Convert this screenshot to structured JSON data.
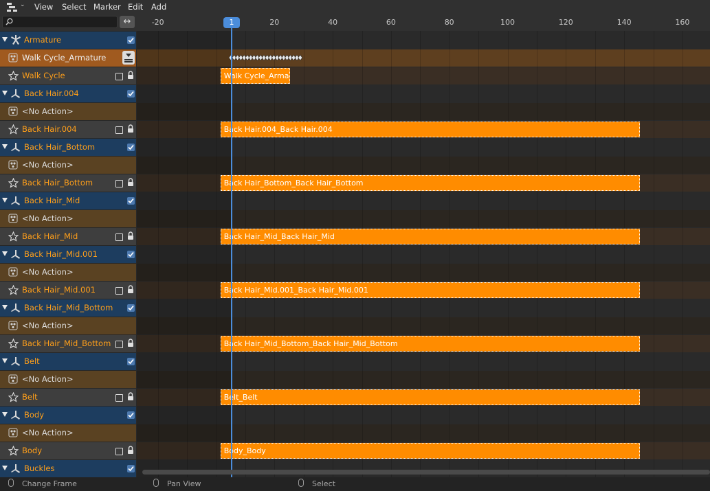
{
  "header": {
    "editor_type_icon": "nla-editor-icon",
    "menus": [
      "View",
      "Select",
      "Marker",
      "Edit",
      "Add"
    ]
  },
  "search": {
    "value": "",
    "placeholder": "",
    "sync_icon": "horizontal-arrows-icon"
  },
  "ruler": {
    "ticks": [
      "-20",
      "20",
      "40",
      "60",
      "80",
      "100",
      "120",
      "140",
      "160"
    ],
    "current_frame": "1"
  },
  "channels": [
    {
      "type": "obj",
      "label": "Armature",
      "icon": "armature-icon"
    },
    {
      "type": "action-line",
      "label": "Walk Cycle_Armature"
    },
    {
      "type": "track",
      "label": "Walk Cycle"
    },
    {
      "type": "obj",
      "label": "Back Hair.004",
      "icon": "bone-icon"
    },
    {
      "type": "act",
      "label": "<No Action>"
    },
    {
      "type": "track",
      "label": "Back Hair.004"
    },
    {
      "type": "obj",
      "label": "Back Hair_Bottom",
      "icon": "bone-icon"
    },
    {
      "type": "act",
      "label": "<No Action>"
    },
    {
      "type": "track",
      "label": "Back Hair_Bottom"
    },
    {
      "type": "obj",
      "label": "Back Hair_Mid",
      "icon": "bone-icon"
    },
    {
      "type": "act",
      "label": "<No Action>"
    },
    {
      "type": "track",
      "label": "Back Hair_Mid"
    },
    {
      "type": "obj",
      "label": "Back Hair_Mid.001",
      "icon": "bone-icon"
    },
    {
      "type": "act",
      "label": "<No Action>"
    },
    {
      "type": "track",
      "label": "Back Hair_Mid.001"
    },
    {
      "type": "obj",
      "label": "Back Hair_Mid_Bottom",
      "icon": "bone-icon"
    },
    {
      "type": "act",
      "label": "<No Action>"
    },
    {
      "type": "track",
      "label": "Back Hair_Mid_Bottom"
    },
    {
      "type": "obj",
      "label": "Belt",
      "icon": "bone-icon"
    },
    {
      "type": "act",
      "label": "<No Action>"
    },
    {
      "type": "track",
      "label": "Belt"
    },
    {
      "type": "obj",
      "label": "Body",
      "icon": "bone-icon"
    },
    {
      "type": "act",
      "label": "<No Action>"
    },
    {
      "type": "track",
      "label": "Body"
    },
    {
      "type": "obj",
      "label": "Buckles",
      "icon": "bone-icon"
    }
  ],
  "strips": [
    {
      "row": 2,
      "label": "Walk Cycle_Arma",
      "start": 1,
      "end": 25
    },
    {
      "row": 5,
      "label": "Back Hair.004_Back Hair.004",
      "start": 1,
      "end": 145
    },
    {
      "row": 8,
      "label": "Back Hair_Bottom_Back Hair_Bottom",
      "start": 1,
      "end": 145
    },
    {
      "row": 11,
      "label": "Back Hair_Mid_Back Hair_Mid",
      "start": 1,
      "end": 145
    },
    {
      "row": 14,
      "label": "Back Hair_Mid.001_Back Hair_Mid.001",
      "start": 1,
      "end": 145
    },
    {
      "row": 17,
      "label": "Back Hair_Mid_Bottom_Back Hair_Mid_Bottom",
      "start": 1,
      "end": 145
    },
    {
      "row": 20,
      "label": "Belt_Belt",
      "start": 1,
      "end": 145
    },
    {
      "row": 23,
      "label": "Body_Body",
      "start": 1,
      "end": 145
    }
  ],
  "status": {
    "hint1": "Change Frame",
    "hint2": "Pan View",
    "hint3": "Select"
  },
  "colors": {
    "accent": "#4b8ddb",
    "strip": "#ff8c00",
    "object_channel": "#1d3d5f",
    "label_orange": "#ff9f1a"
  }
}
